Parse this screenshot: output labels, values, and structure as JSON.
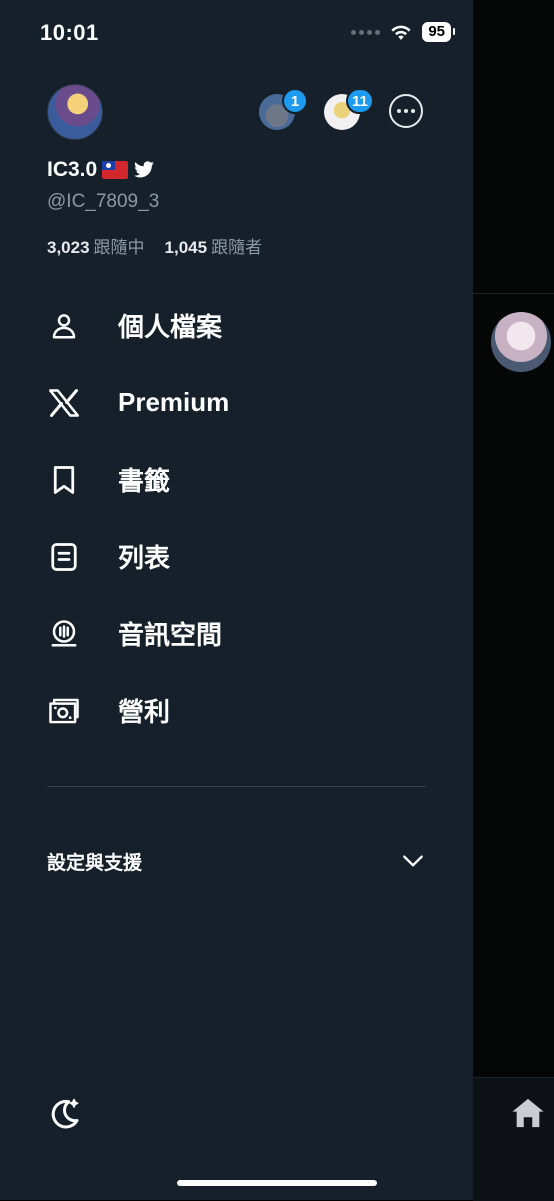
{
  "status_bar": {
    "time": "10:01",
    "battery": "95"
  },
  "profile": {
    "display_name": "IC3.0",
    "handle": "@IC_7809_3",
    "following_count": "3,023",
    "following_label": "跟隨中",
    "followers_count": "1,045",
    "followers_label": "跟隨者"
  },
  "accounts": [
    {
      "badge": "1"
    },
    {
      "badge": "11"
    }
  ],
  "menu": {
    "items": [
      {
        "label": "個人檔案",
        "icon": "person-icon"
      },
      {
        "label": "Premium",
        "icon": "x-logo-icon"
      },
      {
        "label": "書籤",
        "icon": "bookmark-icon"
      },
      {
        "label": "列表",
        "icon": "list-icon"
      },
      {
        "label": "音訊空間",
        "icon": "spaces-icon"
      },
      {
        "label": "營利",
        "icon": "monetization-icon"
      }
    ]
  },
  "settings": {
    "label": "設定與支援"
  },
  "colors": {
    "drawer_bg": "#15202b",
    "accent": "#1d9bf0",
    "muted_text": "#8b98a5"
  }
}
